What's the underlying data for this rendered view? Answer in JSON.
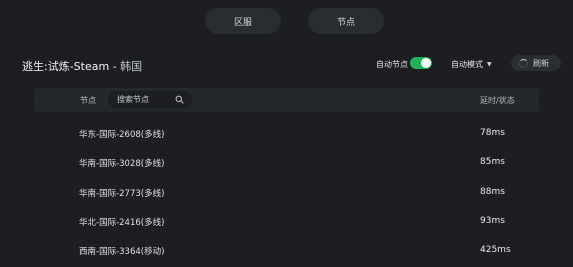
{
  "tabs": [
    {
      "label": "区服"
    },
    {
      "label": "节点"
    }
  ],
  "header": {
    "title": "逃生:试炼-Steam - ",
    "region": "韩国",
    "auto_node_label": "自动节点",
    "auto_node_enabled": true,
    "auto_mode_label": "自动模式",
    "refresh_label": "刷新"
  },
  "table": {
    "col_node": "节点",
    "search_placeholder": "搜索节点",
    "col_latency": "延时/状态",
    "rows": [
      {
        "name": "华东-国际-2608(多线)",
        "latency": "78ms"
      },
      {
        "name": "华南-国际-3028(多线)",
        "latency": "85ms"
      },
      {
        "name": "华南-国际-2773(多线)",
        "latency": "88ms"
      },
      {
        "name": "华北-国际-2416(多线)",
        "latency": "93ms"
      },
      {
        "name": "西南-国际-3364(移动)",
        "latency": "425ms"
      }
    ]
  },
  "colors": {
    "background": "#1c1e22",
    "toggle_on": "#1fb25a"
  },
  "icons": {
    "search": "search-icon",
    "refresh": "refresh-spinner-icon",
    "dropdown": "caret-down-icon"
  }
}
